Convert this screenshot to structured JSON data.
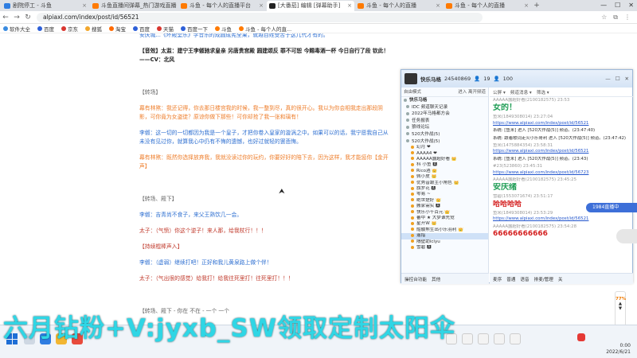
{
  "tabs": [
    {
      "label": "剧院停工 - 斗鱼"
    },
    {
      "label": "斗鱼直播间弹幕_热门游戏直播"
    },
    {
      "label": "斗鱼 - 每个人的直播平台"
    },
    {
      "label": "[大番茄]  编辑 [弹幕助手]"
    },
    {
      "label": "斗鱼 - 每个人的直播"
    },
    {
      "label": "斗鱼 - 每个人的直播"
    }
  ],
  "address": {
    "url": "alpiaxl.com/index/post/id/56521"
  },
  "bookmarks": [
    {
      "label": "软件大全",
      "color": "#3a8be0"
    },
    {
      "label": "百度",
      "color": "#2d5fd8"
    },
    {
      "label": "京东",
      "color": "#d9362f"
    },
    {
      "label": "搜狐",
      "color": "#f2a72c"
    },
    {
      "label": "淘宝",
      "color": "#ff6a00"
    },
    {
      "label": "百度",
      "color": "#2d5fd8"
    },
    {
      "label": "天猫",
      "color": "#d9362f"
    },
    {
      "label": "百度一下",
      "color": "#2d5fd8"
    },
    {
      "label": "斗鱼",
      "color": "#ff7a00"
    },
    {
      "label": "斗鱼 - 每个人的直...",
      "color": "#ff7a00"
    }
  ],
  "article": {
    "line0": "安庆城...《坏殿堂乐》学音乐的成圆成宪全果，就越百姓受苦于这几代才有的。",
    "bold1": "【音效】太监：建宁王李俶驰求皇亲 另唐贵宫殿 圆建颂反 罪不可恕 今赐毒酒一杯 今日自行了段 钦此！——CV：北风",
    "h1": "【转场】",
    "o1": "幕有林煞：我还记得，你去那日楼宫我的时候，我一整到尽，真的很开心。我以为你会相我走出那段阴影，可你竟为女盗徒？原谅你做下那些！可你却抢了我一张和璃有！",
    "b1": "李俶：这一切的一切都因为我是一个皇子，才把你卷入皇家的漩涡之中。如果可以的话，我宁愿我自己从未没有见过你，就算我心中仍有不悔的遗憾，也好过就轻的罢悲悔。",
    "o2": "幕有林煞：既然你选择放弃我，我就没读过你的玩约，你要好好的陪下去，因为这样，我才能惩你【金开声】",
    "h2": "【转场、殿下】",
    "b2": "李俶：吉青尚不食子，来父王熟饮几一会。",
    "r1": "太子：（气愤）你这个逆子！来人那，给我杖行！！！",
    "h3": "【持续棍棒声入】",
    "b3": "李俶：（虚弱）继续打吧！正好和我儿黄泉路上做个伴！",
    "r2": "太子：（气出很的感觉）给我打！给我往死里打！往死里打！！！",
    "tail": "【转场、殿下 - 你在 不在 - 一个 一个"
  },
  "chat": {
    "title": "快乐马格",
    "room_id": "24540869",
    "count_a": "19",
    "count_b": "100",
    "left_header_a": "自由模式",
    "left_header_b": "进入  离开频道",
    "channels": [
      {
        "label": "快乐马格",
        "main": true
      },
      {
        "label": "IDC 频道聊天记录",
        "main": false
      },
      {
        "label": "2022年马格都方会",
        "main": false
      },
      {
        "label": "任务报表",
        "main": false
      },
      {
        "label": "狼线论坛",
        "main": false
      },
      {
        "label": "520大作战(5)",
        "main": false
      },
      {
        "label": "520大作战(5)",
        "main": false
      }
    ],
    "users": [
      {
        "label": "幻月 ❤",
        "sel": false
      },
      {
        "label": "AAAA4 ❤",
        "sel": false
      },
      {
        "label": "AAAAA露超好看 👑",
        "sel": false
      },
      {
        "label": "科 小鱼 🅰",
        "sel": false
      },
      {
        "label": "Rico酒 👑",
        "sel": false
      },
      {
        "label": "佩小皮 👑",
        "sel": false
      },
      {
        "label": "优秀音跟主小角色 👑",
        "sel": false
      },
      {
        "label": "旗罗花 🅰",
        "sel": false
      },
      {
        "label": "零易 ~",
        "sel": false
      },
      {
        "label": "绝世楚好 👑",
        "sel": false
      },
      {
        "label": "搬家需实 🅰",
        "sel": false
      },
      {
        "label": "快乐小千百元 👑",
        "sel": false
      },
      {
        "label": "蕃中 ★ 大梦谁先觉",
        "sel": false
      },
      {
        "label": "星开W 👑",
        "sel": false
      },
      {
        "label": "骷髅熊生出小乐羽利 👑",
        "sel": false
      },
      {
        "label": "遥指",
        "sel": true
      },
      {
        "label": "隔壁助iciyu",
        "sel": false
      },
      {
        "label": "雪碧 🅰",
        "sel": false
      }
    ],
    "left_footer": [
      "操控台功能",
      "其他"
    ],
    "right_tabs": [
      "公屏 ▾",
      "频道消息 ▾",
      "筛选 ▾"
    ],
    "messages": [
      {
        "head": "AAAAA露超好看(2100182575) 23:53",
        "body": "女的！",
        "style": "big"
      },
      {
        "head": "鱼米(1849308014) 23:27:04",
        "body": "https://www.alpiaxi.com/index/post/id/56521",
        "style": "link"
      },
      {
        "head": "",
        "body": "系统: [鱼米] 进入 [520大作战(5)] 频道。(23:47:40)",
        "style": "plain"
      },
      {
        "head": "",
        "body": "系统: 跟着歌词走火小乐哥利 进入 [520大作战(5)] 频道。(23:47:42)",
        "style": "plain"
      },
      {
        "head": "鱼米(1475884354) 23:58:31",
        "body": "https://www.alpiaxi.com/index/post/id/56521",
        "style": "link"
      },
      {
        "head": "",
        "body": "系统: [鱼米] 进入 [520大作战(5)] 频道。(23:43)",
        "style": "plain"
      },
      {
        "head": "#23(523860) 23:45:31",
        "body": "https://www.alpiaxi.com/index/post/id/56723",
        "style": "link"
      },
      {
        "head": "AAAAA露超好看(2100182575) 23:45:25",
        "body": "安庆绪",
        "style": "big"
      },
      {
        "head": "雪碧(1553071674) 23:51:17",
        "body": "哈哈哈哈",
        "style": "bigred"
      },
      {
        "head": "鱼米(1849308014) 23:53:29",
        "body": "https://www.alpiaxi.com/index/post/id/56521",
        "style": "link"
      },
      {
        "head": "AAAAA露超好看(2100182575) 23:54:28",
        "body": "66666666666",
        "style": "bigred"
      }
    ],
    "input_bar": [
      "麦序",
      "普通",
      "语音",
      "排麦/管理",
      "关"
    ]
  },
  "side_pill": "1984直播中",
  "scroll": {
    "pct": "77%"
  },
  "tray": {
    "time": "0:00",
    "date": "2022/6/21"
  },
  "banner": "六月钻粉+V:jyxb_SW领取定制太阳伞"
}
